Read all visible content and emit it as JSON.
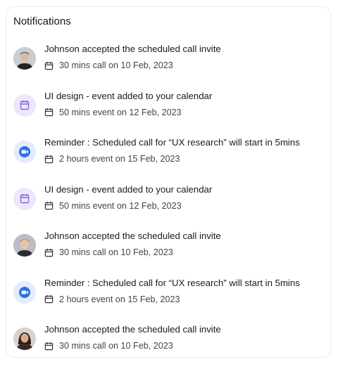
{
  "header": {
    "title": "Notifications"
  },
  "notifications": [
    {
      "avatar": "person-avatar",
      "message": "Johnson accepted the scheduled call invite",
      "meta": "30 mins call on 10 Feb, 2023"
    },
    {
      "avatar": "calendar-icon",
      "message": "UI design - event added to your calendar",
      "meta": "50 mins event on 12 Feb, 2023"
    },
    {
      "avatar": "video-camera-icon",
      "message": "Reminder : Scheduled call for “UX research” will start in 5mins",
      "meta": "2 hours event on 15 Feb, 2023"
    },
    {
      "avatar": "calendar-icon",
      "message": "UI design - event added to your calendar",
      "meta": "50 mins event on 12 Feb, 2023"
    },
    {
      "avatar": "person-avatar",
      "message": "Johnson accepted the scheduled call invite",
      "meta": "30 mins call on 10 Feb, 2023"
    },
    {
      "avatar": "video-camera-icon",
      "message": "Reminder : Scheduled call for “UX research” will start in 5mins",
      "meta": "2 hours event on 15 Feb, 2023"
    },
    {
      "avatar": "person-avatar",
      "message": "Johnson accepted the scheduled call invite",
      "meta": "30 mins call on 10 Feb, 2023"
    }
  ],
  "colors": {
    "calendar_accent": "#8a63e0",
    "video_accent": "#2f6fe6"
  }
}
